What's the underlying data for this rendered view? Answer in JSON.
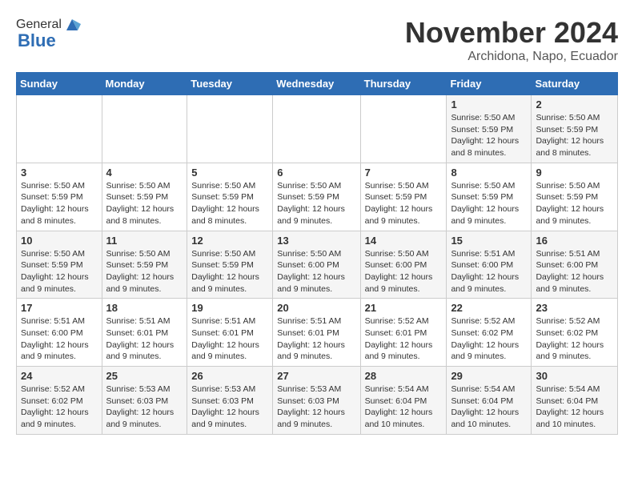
{
  "header": {
    "logo_general": "General",
    "logo_blue": "Blue",
    "month_title": "November 2024",
    "subtitle": "Archidona, Napo, Ecuador"
  },
  "calendar": {
    "days_of_week": [
      "Sunday",
      "Monday",
      "Tuesday",
      "Wednesday",
      "Thursday",
      "Friday",
      "Saturday"
    ],
    "weeks": [
      [
        {
          "day": "",
          "info": ""
        },
        {
          "day": "",
          "info": ""
        },
        {
          "day": "",
          "info": ""
        },
        {
          "day": "",
          "info": ""
        },
        {
          "day": "",
          "info": ""
        },
        {
          "day": "1",
          "info": "Sunrise: 5:50 AM\nSunset: 5:59 PM\nDaylight: 12 hours and 8 minutes."
        },
        {
          "day": "2",
          "info": "Sunrise: 5:50 AM\nSunset: 5:59 PM\nDaylight: 12 hours and 8 minutes."
        }
      ],
      [
        {
          "day": "3",
          "info": "Sunrise: 5:50 AM\nSunset: 5:59 PM\nDaylight: 12 hours and 8 minutes."
        },
        {
          "day": "4",
          "info": "Sunrise: 5:50 AM\nSunset: 5:59 PM\nDaylight: 12 hours and 8 minutes."
        },
        {
          "day": "5",
          "info": "Sunrise: 5:50 AM\nSunset: 5:59 PM\nDaylight: 12 hours and 8 minutes."
        },
        {
          "day": "6",
          "info": "Sunrise: 5:50 AM\nSunset: 5:59 PM\nDaylight: 12 hours and 9 minutes."
        },
        {
          "day": "7",
          "info": "Sunrise: 5:50 AM\nSunset: 5:59 PM\nDaylight: 12 hours and 9 minutes."
        },
        {
          "day": "8",
          "info": "Sunrise: 5:50 AM\nSunset: 5:59 PM\nDaylight: 12 hours and 9 minutes."
        },
        {
          "day": "9",
          "info": "Sunrise: 5:50 AM\nSunset: 5:59 PM\nDaylight: 12 hours and 9 minutes."
        }
      ],
      [
        {
          "day": "10",
          "info": "Sunrise: 5:50 AM\nSunset: 5:59 PM\nDaylight: 12 hours and 9 minutes."
        },
        {
          "day": "11",
          "info": "Sunrise: 5:50 AM\nSunset: 5:59 PM\nDaylight: 12 hours and 9 minutes."
        },
        {
          "day": "12",
          "info": "Sunrise: 5:50 AM\nSunset: 5:59 PM\nDaylight: 12 hours and 9 minutes."
        },
        {
          "day": "13",
          "info": "Sunrise: 5:50 AM\nSunset: 6:00 PM\nDaylight: 12 hours and 9 minutes."
        },
        {
          "day": "14",
          "info": "Sunrise: 5:50 AM\nSunset: 6:00 PM\nDaylight: 12 hours and 9 minutes."
        },
        {
          "day": "15",
          "info": "Sunrise: 5:51 AM\nSunset: 6:00 PM\nDaylight: 12 hours and 9 minutes."
        },
        {
          "day": "16",
          "info": "Sunrise: 5:51 AM\nSunset: 6:00 PM\nDaylight: 12 hours and 9 minutes."
        }
      ],
      [
        {
          "day": "17",
          "info": "Sunrise: 5:51 AM\nSunset: 6:00 PM\nDaylight: 12 hours and 9 minutes."
        },
        {
          "day": "18",
          "info": "Sunrise: 5:51 AM\nSunset: 6:01 PM\nDaylight: 12 hours and 9 minutes."
        },
        {
          "day": "19",
          "info": "Sunrise: 5:51 AM\nSunset: 6:01 PM\nDaylight: 12 hours and 9 minutes."
        },
        {
          "day": "20",
          "info": "Sunrise: 5:51 AM\nSunset: 6:01 PM\nDaylight: 12 hours and 9 minutes."
        },
        {
          "day": "21",
          "info": "Sunrise: 5:52 AM\nSunset: 6:01 PM\nDaylight: 12 hours and 9 minutes."
        },
        {
          "day": "22",
          "info": "Sunrise: 5:52 AM\nSunset: 6:02 PM\nDaylight: 12 hours and 9 minutes."
        },
        {
          "day": "23",
          "info": "Sunrise: 5:52 AM\nSunset: 6:02 PM\nDaylight: 12 hours and 9 minutes."
        }
      ],
      [
        {
          "day": "24",
          "info": "Sunrise: 5:52 AM\nSunset: 6:02 PM\nDaylight: 12 hours and 9 minutes."
        },
        {
          "day": "25",
          "info": "Sunrise: 5:53 AM\nSunset: 6:03 PM\nDaylight: 12 hours and 9 minutes."
        },
        {
          "day": "26",
          "info": "Sunrise: 5:53 AM\nSunset: 6:03 PM\nDaylight: 12 hours and 9 minutes."
        },
        {
          "day": "27",
          "info": "Sunrise: 5:53 AM\nSunset: 6:03 PM\nDaylight: 12 hours and 9 minutes."
        },
        {
          "day": "28",
          "info": "Sunrise: 5:54 AM\nSunset: 6:04 PM\nDaylight: 12 hours and 10 minutes."
        },
        {
          "day": "29",
          "info": "Sunrise: 5:54 AM\nSunset: 6:04 PM\nDaylight: 12 hours and 10 minutes."
        },
        {
          "day": "30",
          "info": "Sunrise: 5:54 AM\nSunset: 6:04 PM\nDaylight: 12 hours and 10 minutes."
        }
      ]
    ]
  }
}
